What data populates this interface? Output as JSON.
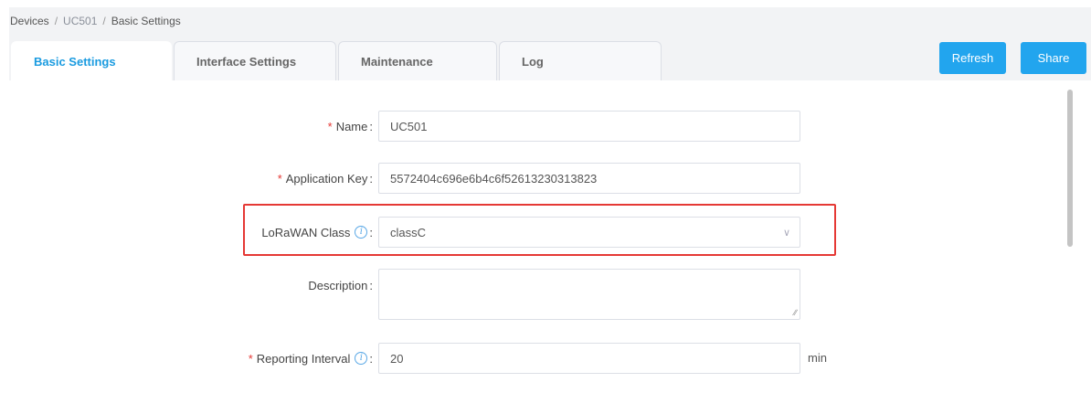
{
  "breadcrumb": {
    "root": "Devices",
    "device": "UC501",
    "current": "Basic Settings"
  },
  "tabs": [
    {
      "label": "Basic Settings",
      "active": true
    },
    {
      "label": "Interface Settings",
      "active": false
    },
    {
      "label": "Maintenance",
      "active": false
    },
    {
      "label": "Log",
      "active": false
    }
  ],
  "actions": {
    "refresh_label": "Refresh",
    "share_label": "Share"
  },
  "form": {
    "name": {
      "label": "Name",
      "required": true,
      "value": "UC501"
    },
    "app_key": {
      "label": "Application Key",
      "required": true,
      "value": "5572404c696e6b4c6f52613230313823"
    },
    "lorawan_class": {
      "label": "LoRaWAN Class",
      "required": false,
      "value": "classC",
      "info_icon": "info-icon"
    },
    "description": {
      "label": "Description",
      "required": false,
      "value": ""
    },
    "reporting_interval": {
      "label": "Reporting Interval",
      "required": true,
      "value": "20",
      "unit": "min",
      "info_icon": "info-icon"
    }
  },
  "colors": {
    "accent": "#22a5ee",
    "active_tab_text": "#1a9be0",
    "required": "#e53935",
    "highlight_border": "#e53935"
  }
}
